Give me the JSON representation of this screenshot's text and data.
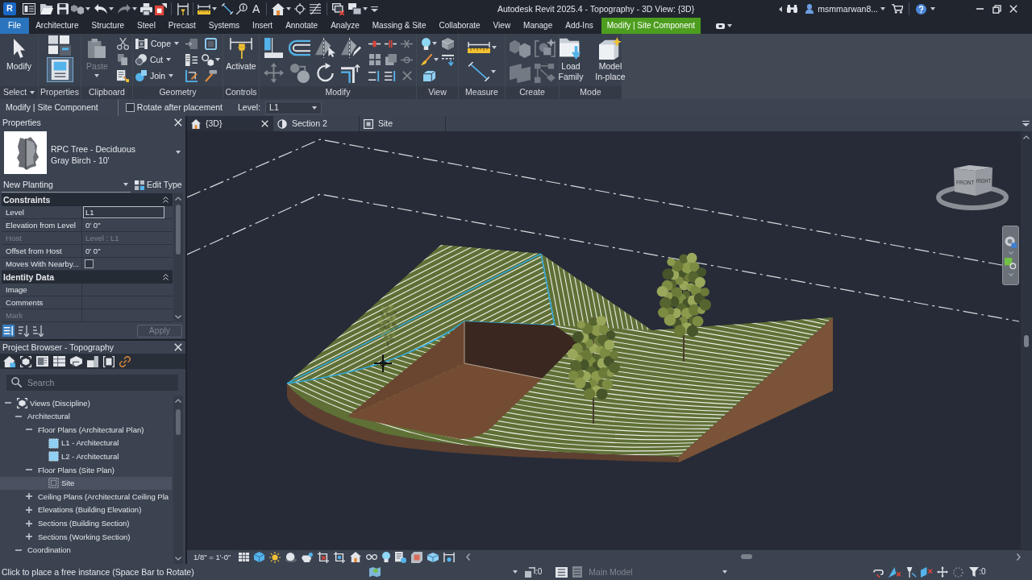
{
  "title_bar": {
    "logo": "R",
    "text_tool": "A",
    "title": "Autodesk Revit 2025.4 - Topography - 3D View: {3D}",
    "user": "msmmarwan8..."
  },
  "ribbon_tabs": [
    {
      "label": "File",
      "kind": "file",
      "selected": false
    },
    {
      "label": "Architecture",
      "kind": "tab",
      "selected": false
    },
    {
      "label": "Structure",
      "kind": "tab",
      "selected": false
    },
    {
      "label": "Steel",
      "kind": "tab",
      "selected": false
    },
    {
      "label": "Precast",
      "kind": "tab",
      "selected": false
    },
    {
      "label": "Systems",
      "kind": "tab",
      "selected": false
    },
    {
      "label": "Insert",
      "kind": "tab",
      "selected": false
    },
    {
      "label": "Annotate",
      "kind": "tab",
      "selected": false
    },
    {
      "label": "Analyze",
      "kind": "tab",
      "selected": false
    },
    {
      "label": "Massing & Site",
      "kind": "tab",
      "selected": false
    },
    {
      "label": "Collaborate",
      "kind": "tab",
      "selected": false
    },
    {
      "label": "View",
      "kind": "tab",
      "selected": false
    },
    {
      "label": "Manage",
      "kind": "tab",
      "selected": false
    },
    {
      "label": "Add-Ins",
      "kind": "tab",
      "selected": false
    },
    {
      "label": "Modify | Site Component",
      "kind": "contextual",
      "selected": true
    }
  ],
  "ribbon_panels": [
    {
      "kind": "select",
      "title": "Select",
      "tools": [
        {
          "label": "Modify",
          "disabled": false
        }
      ]
    },
    {
      "kind": "properties",
      "title": "Properties"
    },
    {
      "kind": "clipboard",
      "title": "Clipboard",
      "tools": [
        {
          "label": "Paste",
          "disabled": true
        }
      ]
    },
    {
      "kind": "geometry",
      "title": "Geometry",
      "tools": [
        {
          "label": "Cope",
          "disabled": false
        },
        {
          "label": "Cut",
          "disabled": false
        },
        {
          "label": "Join",
          "disabled": false
        }
      ]
    },
    {
      "kind": "controls",
      "title": "Controls",
      "tools": [
        {
          "label": "Activate",
          "disabled": false
        }
      ]
    },
    {
      "kind": "modify",
      "title": "Modify"
    },
    {
      "kind": "view",
      "title": "View"
    },
    {
      "kind": "measure",
      "title": "Measure"
    },
    {
      "kind": "create",
      "title": "Create"
    },
    {
      "kind": "mode",
      "title": "Mode",
      "tools": [
        {
          "label": "Load Family",
          "disabled": false
        },
        {
          "label": "Model In-place",
          "disabled": false
        }
      ]
    }
  ],
  "options_bar": {
    "context": "Modify | Site Component",
    "rotate_after_placement": {
      "label": "Rotate after placement",
      "checked": false
    },
    "level": {
      "label": "Level:",
      "value": "L1"
    }
  },
  "properties": {
    "title": "Properties",
    "type_family": "RPC Tree - Deciduous",
    "type_name": "Gray Birch - 10'",
    "instance_filter": "New Planting",
    "edit_type": "Edit Type",
    "groups": [
      {
        "title": "Constraints",
        "expanded": true,
        "rows": [
          {
            "name": "Level",
            "kind": "text",
            "value": "L1",
            "disabled": false,
            "selected": true
          },
          {
            "name": "Elevation from Level",
            "kind": "text",
            "value": "0' 0\"",
            "disabled": false,
            "selected": false
          },
          {
            "name": "Host",
            "kind": "text",
            "value": "Level : L1",
            "disabled": true,
            "selected": false
          },
          {
            "name": "Offset from Host",
            "kind": "text",
            "value": "0' 0\"",
            "disabled": false,
            "selected": false
          },
          {
            "name": "Moves With Nearby...",
            "kind": "checkbox",
            "checked": false,
            "disabled": false,
            "selected": false
          }
        ]
      },
      {
        "title": "Identity Data",
        "expanded": true,
        "rows": [
          {
            "name": "Image",
            "kind": "text",
            "disabled": false,
            "selected": false
          },
          {
            "name": "Comments",
            "kind": "text",
            "disabled": false,
            "selected": false
          },
          {
            "name": "Mark",
            "kind": "text",
            "disabled": true,
            "selected": false
          }
        ]
      }
    ],
    "apply": {
      "label": "Apply",
      "disabled": true
    }
  },
  "project_browser": {
    "title": "Project Browser - Topography",
    "search": {
      "placeholder": "Search"
    },
    "tree": [
      {
        "label": "Views (Discipline)",
        "kind": "views",
        "expanded": true,
        "selected": false,
        "children": [
          {
            "label": "Architectural",
            "expanded": true,
            "selected": false,
            "children": [
              {
                "label": "Floor Plans (Architectural Plan)",
                "expanded": true,
                "selected": false,
                "children": [
                  {
                    "label": "L1 - Architectural",
                    "kind": "plan",
                    "selected": false
                  },
                  {
                    "label": "L2 - Architectural",
                    "kind": "plan",
                    "selected": false
                  }
                ]
              },
              {
                "label": "Floor Plans (Site Plan)",
                "expanded": true,
                "selected": false,
                "children": [
                  {
                    "label": "Site",
                    "kind": "site",
                    "selected": true
                  }
                ]
              },
              {
                "label": "Ceiling Plans (Architectural Ceiling Pla",
                "expanded": false,
                "selected": false
              },
              {
                "label": "Elevations (Building Elevation)",
                "expanded": false,
                "selected": false
              },
              {
                "label": "Sections (Building Section)",
                "expanded": false,
                "selected": false
              },
              {
                "label": "Sections (Working Section)",
                "expanded": false,
                "selected": false
              }
            ]
          },
          {
            "label": "Coordination",
            "expanded": true,
            "selected": false
          }
        ]
      }
    ]
  },
  "view_tabs": [
    {
      "label": "{3D}",
      "kind": "model",
      "selected": true
    },
    {
      "label": "Section 2",
      "kind": "section",
      "selected": false
    },
    {
      "label": "Site",
      "kind": "plan",
      "selected": false
    }
  ],
  "view_cube": {
    "faces": [
      "FRONT",
      "RIGHT"
    ]
  },
  "view_control_bar": {
    "scale": "1/8\" = 1'-0\""
  },
  "status_bar": {
    "message": "Click to place a free instance (Space Bar to Rotate)",
    "workset_count": ":0",
    "model": {
      "label": "Main Model",
      "disabled": true
    },
    "filter_count": ":0"
  }
}
